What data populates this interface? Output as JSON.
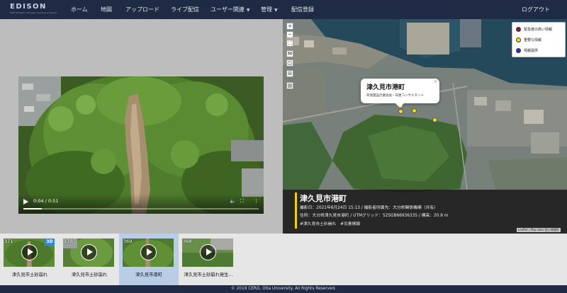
{
  "brand": {
    "name": "EDISON",
    "tagline": "Earth Disaster Intelligent Systems & Operational Network"
  },
  "nav": {
    "items": [
      {
        "label": "ホーム"
      },
      {
        "label": "地図"
      },
      {
        "label": "アップロード"
      },
      {
        "label": "ライブ配信"
      },
      {
        "label": "ユーザー関連"
      },
      {
        "label": "管理"
      },
      {
        "label": "配信登録"
      }
    ],
    "logout": "ログアウト"
  },
  "video": {
    "time": "0:04 / 0:51",
    "progress": 0.078
  },
  "map": {
    "controls": [
      "+",
      "−",
      "⛶",
      "M",
      "◫",
      "⊟",
      "▤"
    ],
    "legend": [
      {
        "label": "緊急度の高い情報",
        "color": "#8c1a4a"
      },
      {
        "label": "重要な情報",
        "color": "#f2e600"
      },
      {
        "label": "情報提供",
        "color": "#1a2fd6"
      }
    ],
    "popup": {
      "title": "津久見市港町",
      "subtitle": "県測量設計業協会・日建コンサルタント",
      "close": "×"
    },
    "info": {
      "title": "津久見市港町",
      "line1": "撮影日：2021年6月24日 15:13 / 撮影者所属先：大分県関係機関（共有）",
      "line2": "住所：大分県津久見市港町 / UTMグリッド：52SGB66936335 / 標高：20.8 m",
      "tags": "#津久見市土砂崩れ　#災害情報"
    },
    "attribution": "Leaflet | Map data 国土地理院"
  },
  "thumbnails": [
    {
      "number": "371",
      "label": "津久見市土砂崩れ",
      "badge": "3D",
      "active": false
    },
    {
      "number": "370",
      "label": "津久見市土砂崩れ",
      "badge": "",
      "active": false
    },
    {
      "number": "369",
      "label": "津久見市港町",
      "badge": "",
      "active": true
    },
    {
      "number": "368",
      "label": "津久見市土砂崩れ発生...",
      "badge": "",
      "active": false
    }
  ],
  "footer": "© 2019 CERD, Oita University. All Rights Reserved.",
  "colors": {
    "navbar": "#1f2a44",
    "accent_bar": "#f2d100",
    "active_thumb": "#b9cde6"
  }
}
